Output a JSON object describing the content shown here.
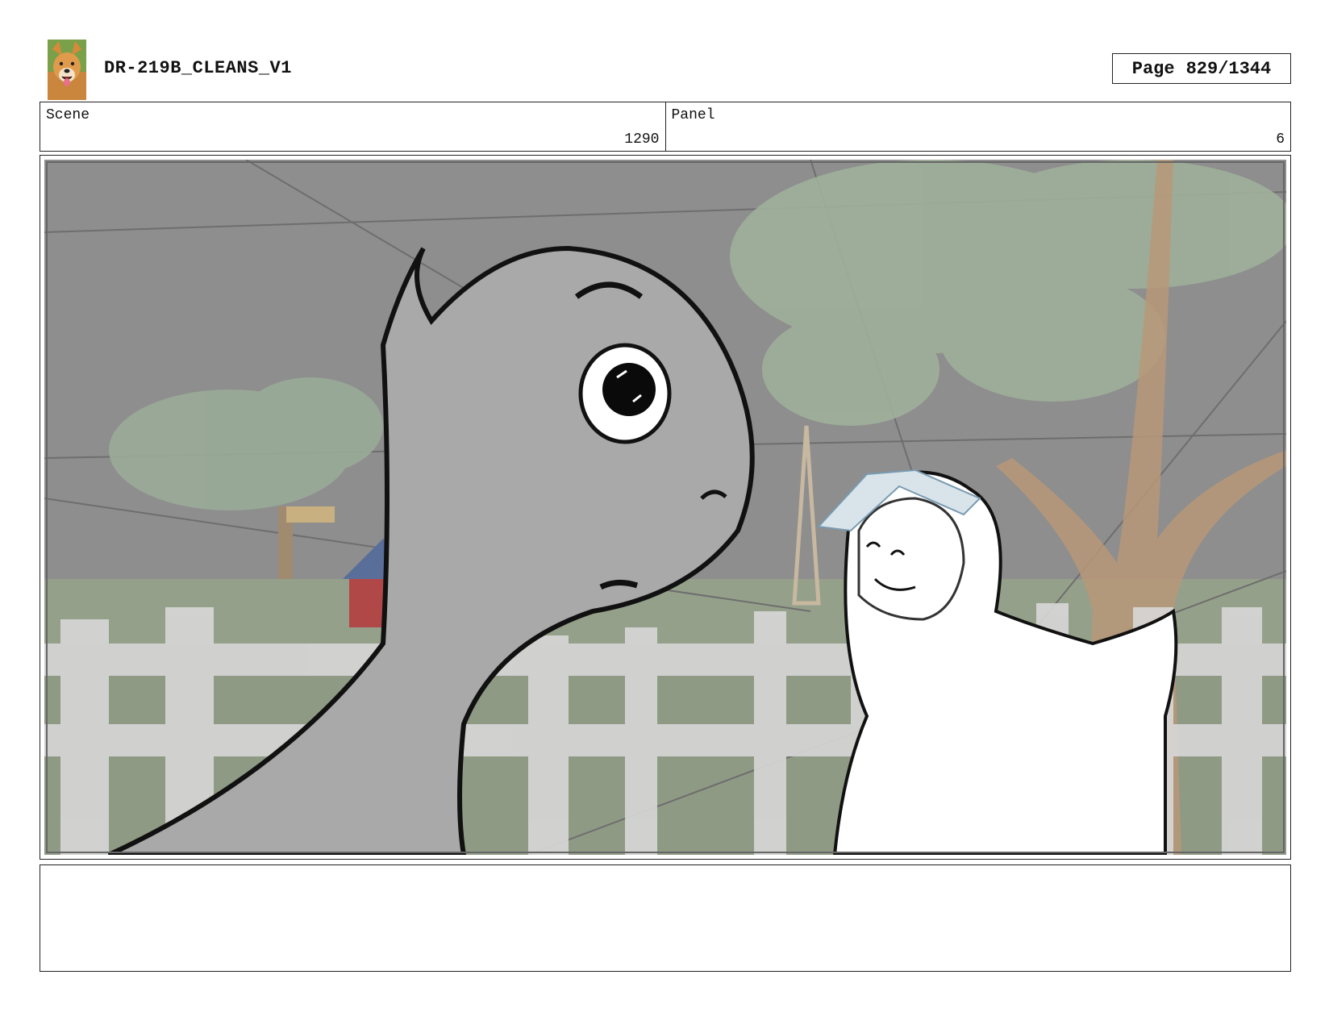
{
  "header": {
    "logo_icon": "dog-photo-icon",
    "title": "DR-219B_CLEANS_V1",
    "page_label": "Page",
    "page_value": "829/1344"
  },
  "info": {
    "scene_label": "Scene",
    "scene_value": "1290",
    "panel_label": "Panel",
    "panel_value": "6"
  },
  "panel": {
    "image_icon": "storyboard-drawing-icon"
  },
  "notes": {
    "text": ""
  }
}
